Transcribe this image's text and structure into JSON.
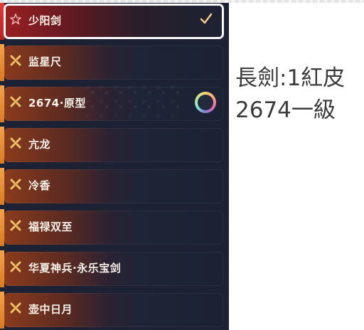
{
  "list": {
    "items": [
      {
        "label": "少阳剑",
        "icon": "star-outline-icon",
        "active": true,
        "trailing": "check-icon"
      },
      {
        "label": "监星尺",
        "icon": "x-cross-icon",
        "active": false,
        "trailing": ""
      },
      {
        "label": "2674·原型",
        "icon": "x-cross-icon",
        "active": false,
        "trailing": "rainbow-ring-icon"
      },
      {
        "label": "亢龙",
        "icon": "x-cross-icon",
        "active": false,
        "trailing": ""
      },
      {
        "label": "冷香",
        "icon": "x-cross-icon",
        "active": false,
        "trailing": ""
      },
      {
        "label": "福禄双至",
        "icon": "x-cross-icon",
        "active": false,
        "trailing": ""
      },
      {
        "label": "华夏神兵·永乐宝剑",
        "icon": "x-cross-icon",
        "active": false,
        "trailing": ""
      },
      {
        "label": "壶中日月",
        "icon": "x-cross-icon",
        "active": false,
        "trailing": ""
      }
    ]
  },
  "note": {
    "line1": "長劍:1紅皮",
    "line2": "2674一級"
  },
  "colors": {
    "accent_orange": "#f2a24a",
    "active_red": "#e23b3b",
    "panel_bg": "#1c2233",
    "icon_gold": "#f0c266"
  }
}
